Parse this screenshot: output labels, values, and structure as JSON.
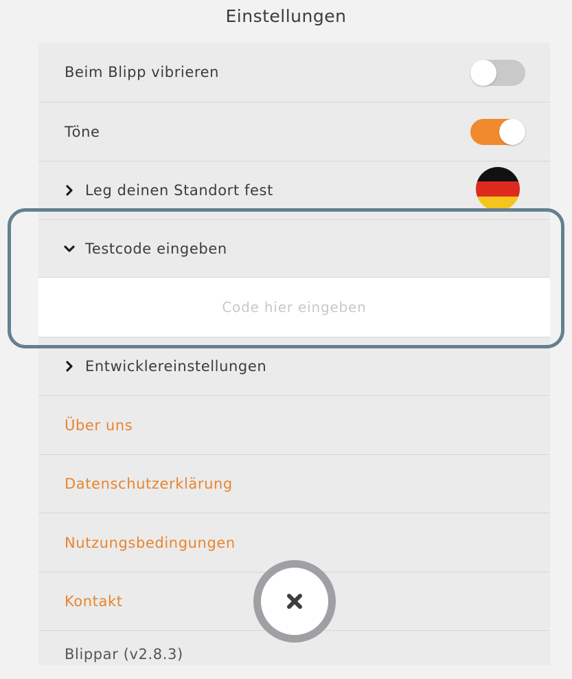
{
  "header": {
    "title": "Einstellungen"
  },
  "settings": {
    "vibrate": {
      "label": "Beim Blipp vibrieren",
      "enabled": false
    },
    "sounds": {
      "label": "Töne",
      "enabled": true
    },
    "location": {
      "label": "Leg deinen Standort fest",
      "flag_icon": "germany-flag-icon"
    },
    "testcode": {
      "label": "Testcode eingeben",
      "expanded": true,
      "placeholder": "Code hier eingeben",
      "value": ""
    },
    "developer": {
      "label": "Entwicklereinstellungen",
      "expanded": false
    }
  },
  "links": {
    "about": "Über uns",
    "privacy": "Datenschutzerklärung",
    "terms": "Nutzungsbedingungen",
    "contact": "Kontakt"
  },
  "footer": {
    "version": "Blippar (v2.8.3)"
  },
  "colors": {
    "accent": "#ef8a2f",
    "link": "#e8852e",
    "highlight_border": "#64808f",
    "toggle_off": "#c9c9c9"
  },
  "icons": {
    "close": "close-icon",
    "collapsed": "chevron-right-icon",
    "expanded": "chevron-down-icon"
  }
}
